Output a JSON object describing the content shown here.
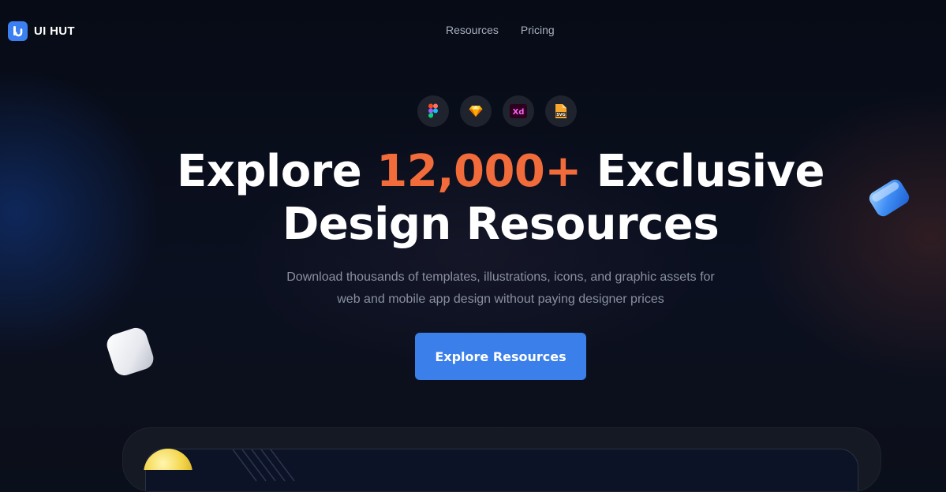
{
  "brand": {
    "name": "UI HUT",
    "color": "#3b7ff0"
  },
  "nav": {
    "items": [
      {
        "label": "Resources"
      },
      {
        "label": "Pricing"
      }
    ]
  },
  "tools": [
    {
      "icon": "figma-icon"
    },
    {
      "icon": "sketch-icon"
    },
    {
      "icon": "adobe-xd-icon",
      "label": "Xd"
    },
    {
      "icon": "svg-file-icon",
      "label": "SVG"
    }
  ],
  "hero": {
    "title_prefix": "Explore ",
    "title_highlight": "12,000+",
    "title_suffix": " Exclusive",
    "title_line2": "Design Resources",
    "subtitle_line1": "Download thousands of templates, illustrations, icons, and graphic assets for",
    "subtitle_line2": "web and mobile app design without paying designer prices",
    "cta_label": "Explore Resources"
  },
  "colors": {
    "background": "#0a0f1c",
    "accent": "#f26b3a",
    "button": "#3a7fea"
  }
}
